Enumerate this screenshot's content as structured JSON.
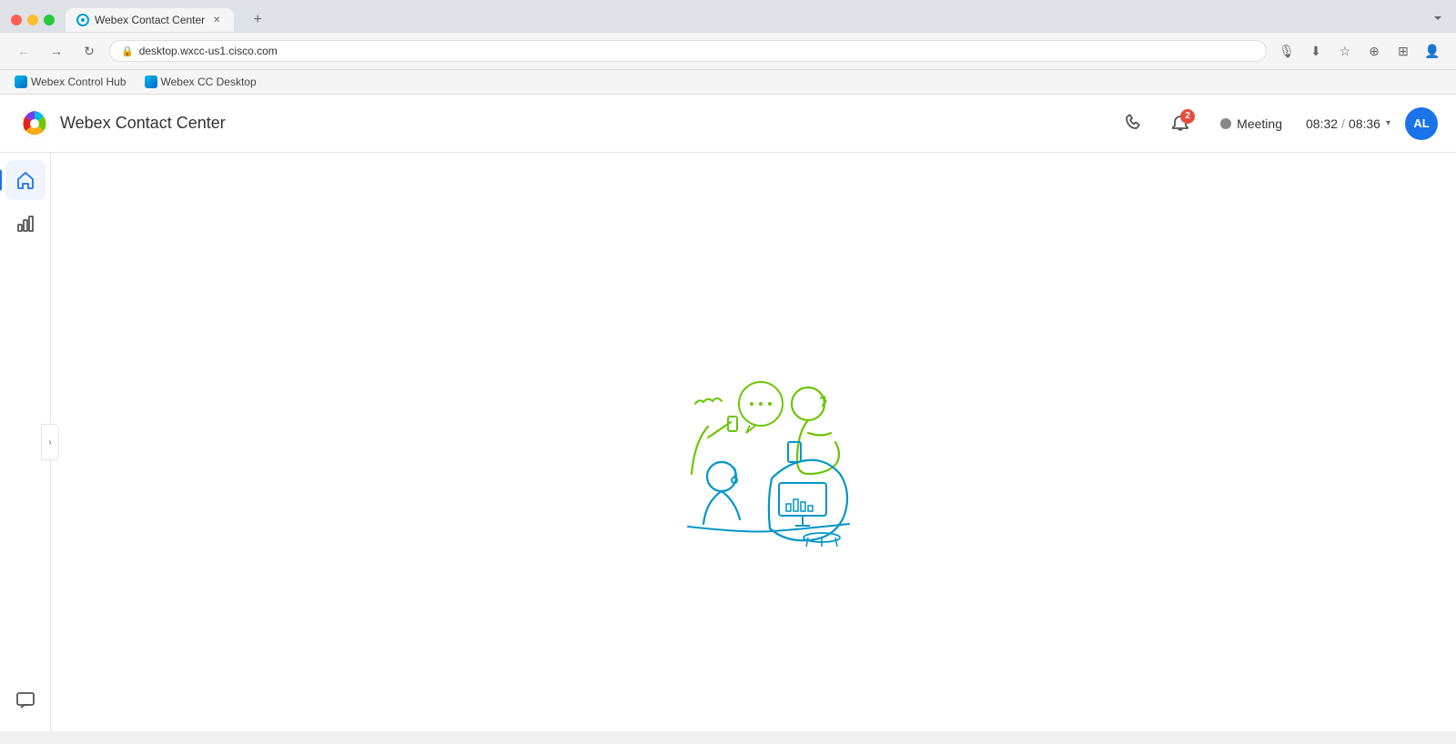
{
  "browser": {
    "tab_title": "Webex Contact Center",
    "tab_favicon_color": "#00a0d2",
    "address": "desktop.wxcc-us1.cisco.com",
    "bookmarks": [
      {
        "label": "Webex Control Hub",
        "id": "bookmark-control-hub"
      },
      {
        "label": "Webex CC Desktop",
        "id": "bookmark-cc-desktop"
      }
    ]
  },
  "app": {
    "title": "Webex Contact Center",
    "header": {
      "notification_count": "2",
      "status_label": "Meeting",
      "timer_current": "08:32",
      "timer_total": "08:36",
      "user_initials": "AL"
    },
    "sidebar": {
      "items": [
        {
          "id": "home",
          "label": "Home",
          "active": true
        },
        {
          "id": "analytics",
          "label": "Analytics",
          "active": false
        }
      ],
      "bottom_items": [
        {
          "id": "chat",
          "label": "Chat"
        }
      ]
    }
  },
  "icons": {
    "home": "⌂",
    "analytics": "📊",
    "phone": "📞",
    "bell": "🔔",
    "chat": "💬",
    "back": "←",
    "forward": "→",
    "reload": "↻",
    "lock": "🔒",
    "star": "★",
    "bookmark": "⊕",
    "extensions": "⊞",
    "profile": "👤",
    "microphone": "🎙",
    "chevron_down": "▾",
    "expand": "›"
  }
}
